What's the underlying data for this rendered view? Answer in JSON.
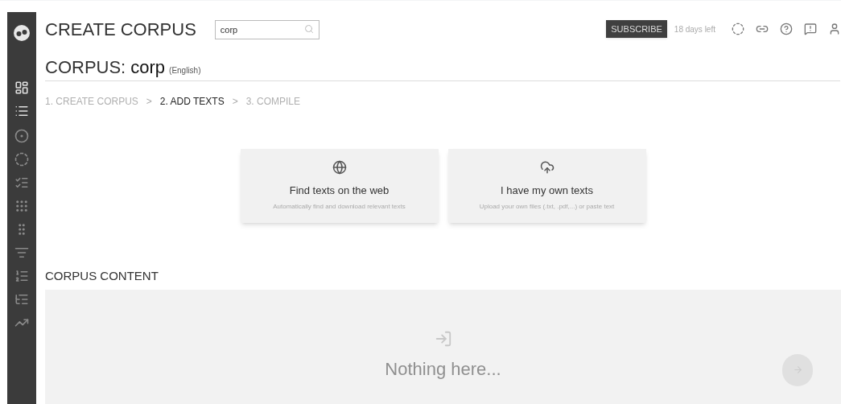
{
  "header": {
    "title": "CREATE CORPUS",
    "search": {
      "value": "corp"
    },
    "subscribe": "SUBSCRIBE",
    "trial": "18 days left"
  },
  "corpus": {
    "label": "CORPUS:",
    "name": "corp",
    "language": "(English)"
  },
  "steps": [
    {
      "label": "1. CREATE CORPUS",
      "selected": false
    },
    {
      "label": "2. ADD TEXTS",
      "selected": true
    },
    {
      "label": "3. COMPILE",
      "selected": false
    }
  ],
  "separators": [
    ">",
    ">"
  ],
  "options": [
    {
      "kind": "web",
      "title": "Find texts on the web",
      "subtitle": "Automatically find and download relevant texts"
    },
    {
      "kind": "upload",
      "title": "I have my own texts",
      "subtitle": "Upload your own files (.txt, .pdf,...) or paste text"
    }
  ],
  "content": {
    "heading": "CORPUS CONTENT",
    "empty": "Nothing here..."
  }
}
